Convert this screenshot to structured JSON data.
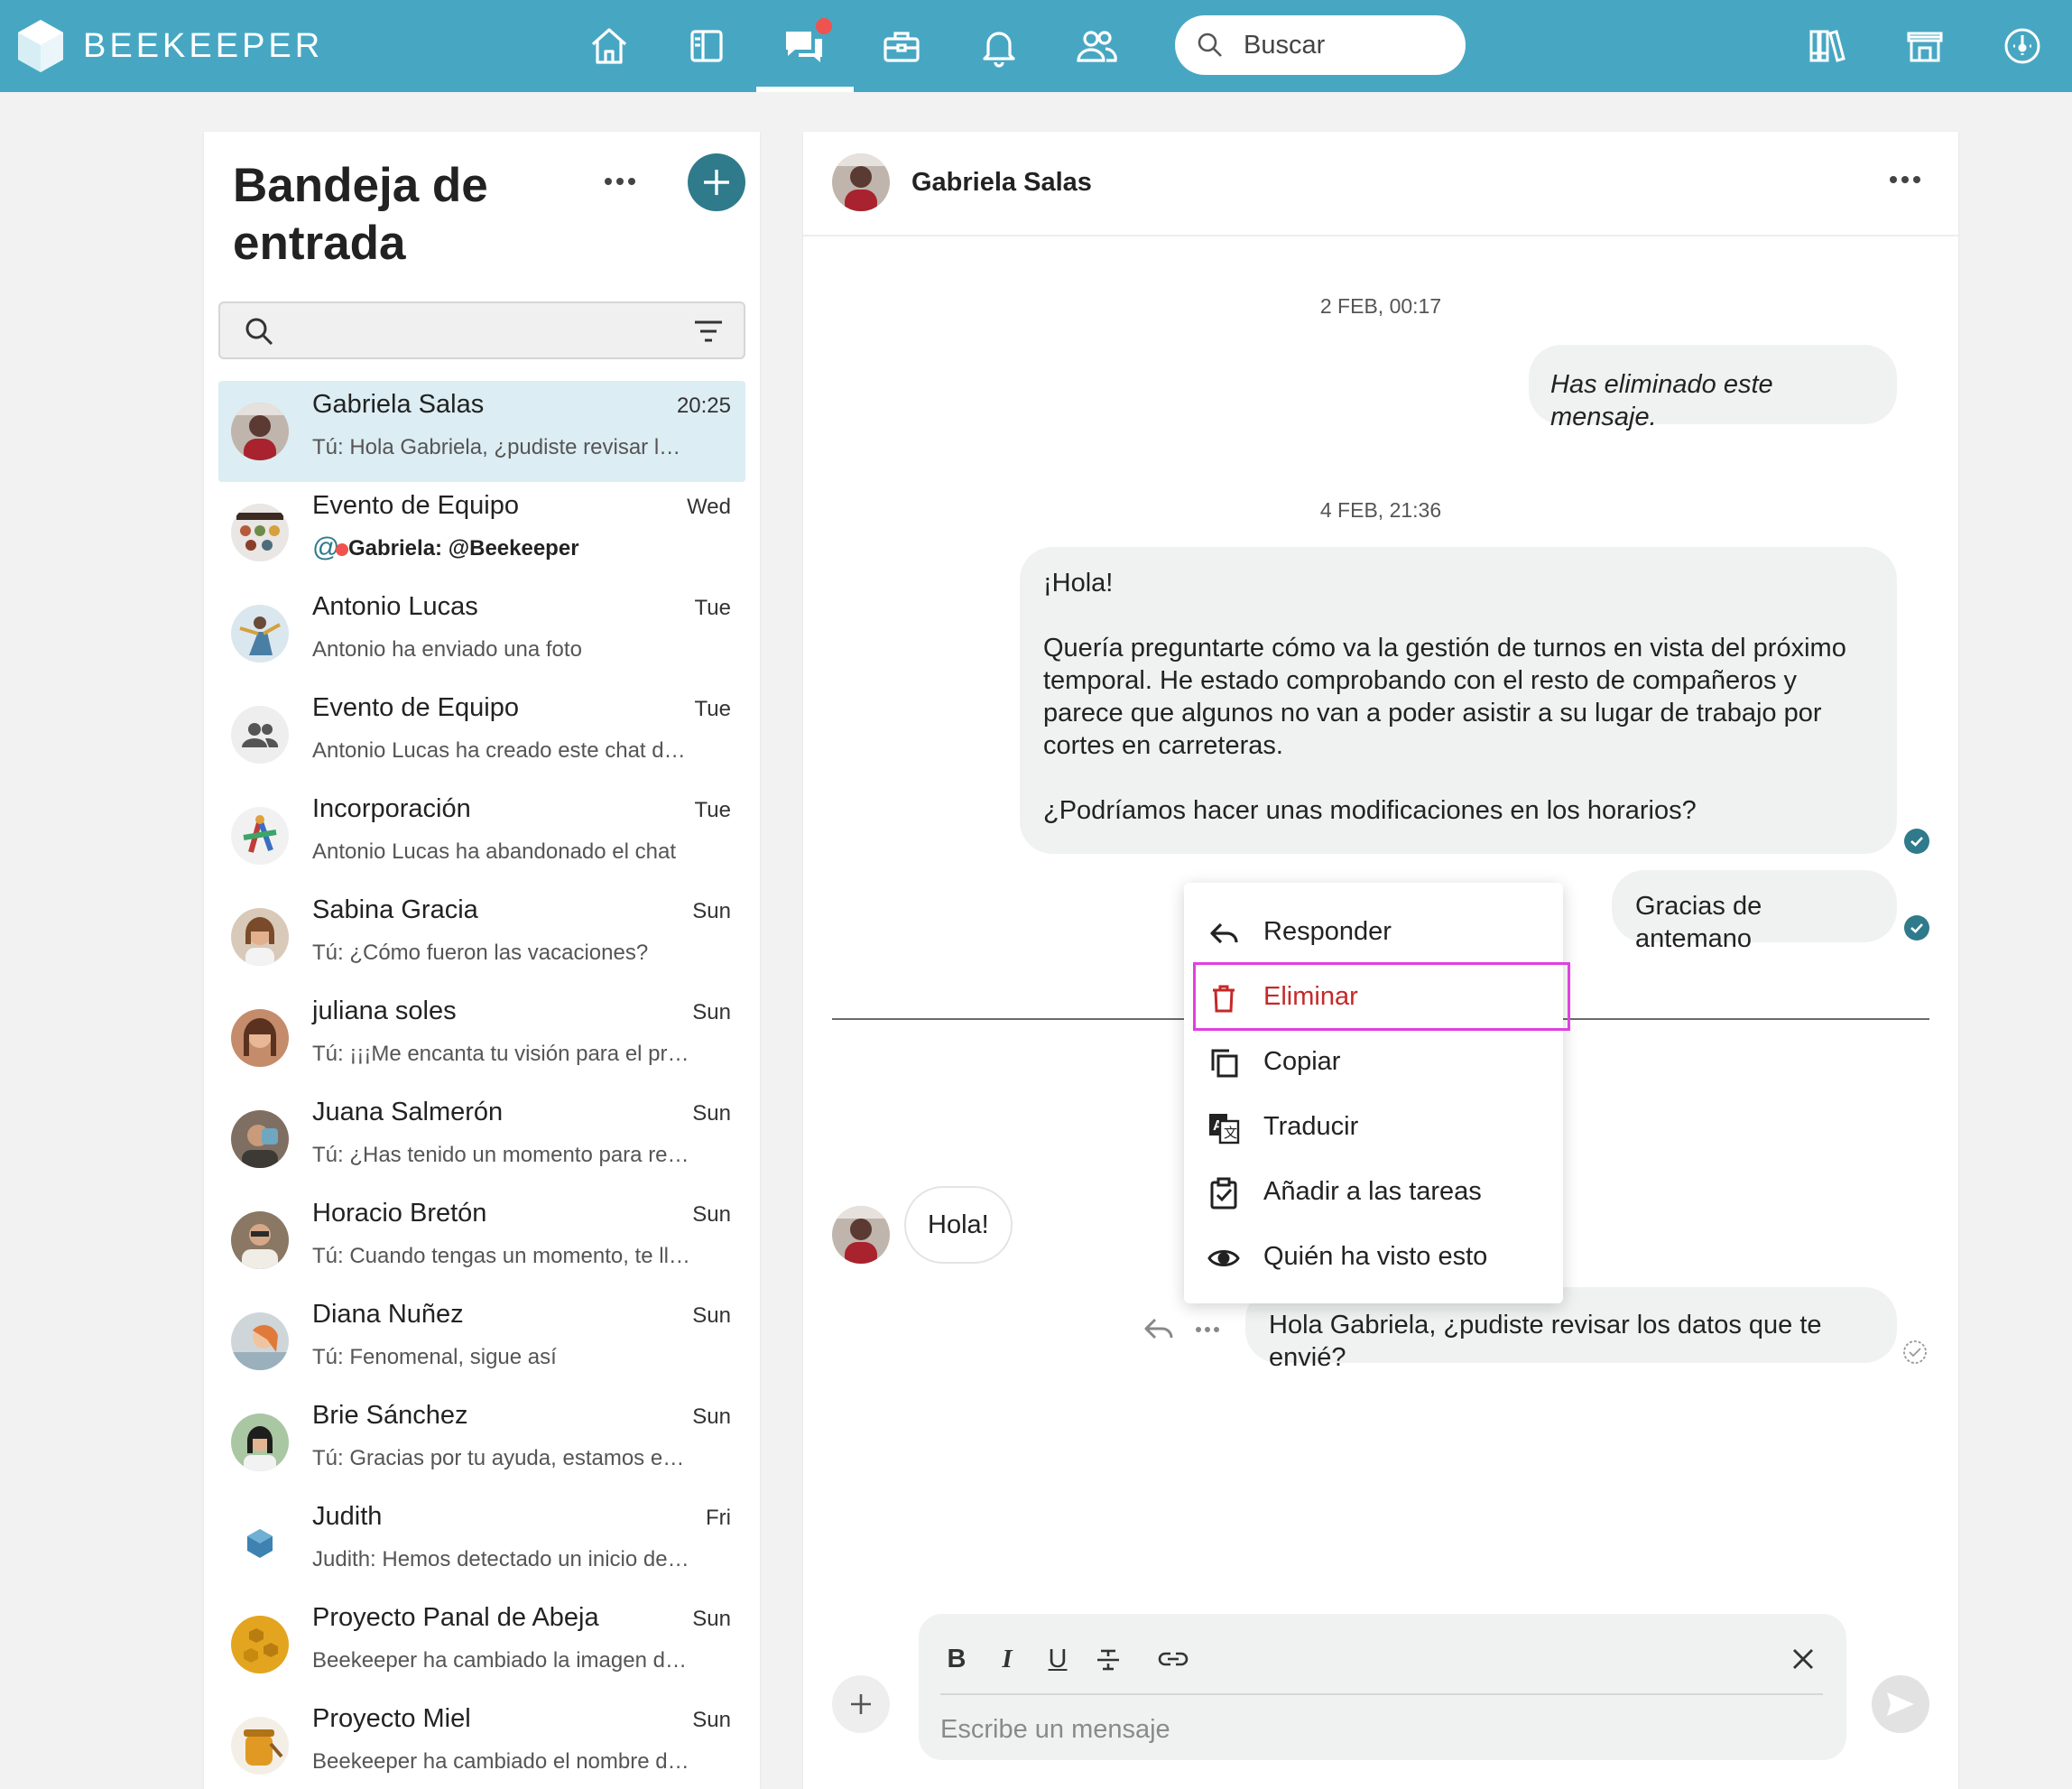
{
  "app": {
    "brand": "BEEKEEPER",
    "accent": "#47a7c3",
    "dark_accent": "#2f7a8b",
    "alert": "#ef5350"
  },
  "topbar": {
    "nav_icons": [
      "home-icon",
      "newsfeed-icon",
      "chat-icon",
      "toolbox-icon",
      "bell-icon",
      "people-icon"
    ],
    "search_placeholder": "Buscar",
    "right_icons": [
      "library-icon",
      "store-icon",
      "dashboard-icon"
    ]
  },
  "inbox": {
    "title": "Bandeja de entrada",
    "conversations": [
      {
        "name": "Gabriela Salas",
        "time": "20:25",
        "preview": "Tú: Hola Gabriela, ¿pudiste revisar los datos que te envié?",
        "selected": true
      },
      {
        "name": "Evento de Equipo",
        "time": "Wed",
        "preview": "Gabriela: @Beekeeper",
        "mention": true
      },
      {
        "name": "Antonio Lucas",
        "time": "Tue",
        "preview": "Antonio ha enviado una foto"
      },
      {
        "name": "Evento de Equipo",
        "time": "Tue",
        "preview": "Antonio Lucas ha creado este chat de grupo"
      },
      {
        "name": "Incorporación",
        "time": "Tue",
        "preview": "Antonio Lucas ha abandonado el chat"
      },
      {
        "name": "Sabina Gracia",
        "time": "Sun",
        "preview": "Tú: ¿Cómo fueron las vacaciones?"
      },
      {
        "name": "juliana soles",
        "time": "Sun",
        "preview": "Tú: ¡¡¡Me encanta tu visión para el proyecto!!!"
      },
      {
        "name": "Juana Salmerón",
        "time": "Sun",
        "preview": "Tú: ¿Has tenido un momento para revisarlo?"
      },
      {
        "name": "Horacio Bretón",
        "time": "Sun",
        "preview": "Tú: Cuando tengas un momento, te llamo"
      },
      {
        "name": "Diana Nuñez",
        "time": "Sun",
        "preview": "Tú: Fenomenal, sigue así"
      },
      {
        "name": "Brie Sánchez",
        "time": "Sun",
        "preview": "Tú: Gracias por tu ayuda, estamos en contacto"
      },
      {
        "name": "Judith",
        "time": "Fri",
        "preview": "Judith: Hemos detectado un inicio de sesión"
      },
      {
        "name": "Proyecto Panal de Abeja",
        "time": "Sun",
        "preview": "Beekeeper ha cambiado la imagen del grupo"
      },
      {
        "name": "Proyecto Miel",
        "time": "Sun",
        "preview": "Beekeeper ha cambiado el nombre del grupo"
      }
    ]
  },
  "chat": {
    "contact": "Gabriela Salas",
    "date1": "2 FEB, 00:17",
    "deleted_msg": "Has eliminado este mensaje.",
    "date2": "4 FEB, 21:36",
    "long_msg": {
      "p1": "¡Hola!",
      "p2": "Quería preguntarte cómo va la gestión de turnos en vista del próximo temporal. He estado comprobando con el resto de compañeros y parece que algunos no van a poder asistir a su lugar de trabajo por cortes en carreteras.",
      "p3": "¿Podríamos hacer unas modificaciones en los horarios?"
    },
    "thanks_msg": "Gracias de antemano",
    "incoming_msg": "Hola!",
    "last_msg": "Hola Gabriela, ¿pudiste revisar los datos que te envié?",
    "composer_placeholder": "Escribe un mensaje",
    "format_buttons": [
      "B",
      "I",
      "U"
    ]
  },
  "context_menu": {
    "items": [
      {
        "label": "Responder",
        "icon": "reply-icon"
      },
      {
        "label": "Eliminar",
        "icon": "trash-icon",
        "danger": true
      },
      {
        "label": "Copiar",
        "icon": "copy-icon"
      },
      {
        "label": "Traducir",
        "icon": "translate-icon"
      },
      {
        "label": "Añadir a las tareas",
        "icon": "task-icon"
      },
      {
        "label": "Quién ha visto esto",
        "icon": "eye-icon"
      }
    ],
    "highlighted": "Eliminar"
  }
}
